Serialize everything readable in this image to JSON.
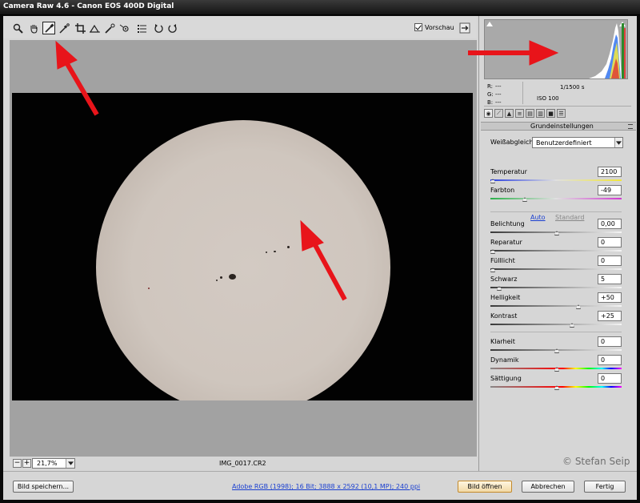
{
  "window": {
    "title": "Camera Raw 4.6 - Canon EOS 400D Digital"
  },
  "toolbar": {
    "tools": [
      {
        "name": "zoom-tool",
        "icon": "magnifier-icon"
      },
      {
        "name": "hand-tool",
        "icon": "hand-icon"
      },
      {
        "name": "white-balance-tool",
        "icon": "eyedropper-icon",
        "selected": true
      },
      {
        "name": "color-sampler-tool",
        "icon": "eyedropper-target-icon"
      },
      {
        "name": "crop-tool",
        "icon": "crop-icon"
      },
      {
        "name": "straighten-tool",
        "icon": "straighten-icon"
      },
      {
        "name": "retouch-tool",
        "icon": "retouch-icon"
      },
      {
        "name": "red-eye-tool",
        "icon": "red-eye-icon"
      },
      {
        "name": "preferences-tool",
        "icon": "list-icon"
      },
      {
        "name": "rotate-left-tool",
        "icon": "rotate-left-icon"
      },
      {
        "name": "rotate-right-tool",
        "icon": "rotate-right-icon"
      }
    ],
    "preview_label": "Vorschau",
    "preview_checked": true
  },
  "canvas": {
    "filename": "IMG_0017.CR2",
    "zoom": "21,7%"
  },
  "histogram": {
    "rgb": [
      {
        "k": "R:",
        "v": "---"
      },
      {
        "k": "G:",
        "v": "---"
      },
      {
        "k": "B:",
        "v": "---"
      }
    ],
    "shutter": "1/1500 s",
    "iso": "ISO 100"
  },
  "panel": {
    "title": "Grundeinstellungen",
    "white_balance_label": "Weißabgleich:",
    "white_balance_value": "Benutzerdefiniert",
    "auto_label": "Auto",
    "standard_label": "Standard",
    "sliders": [
      {
        "label": "Temperatur",
        "value": "2100",
        "pos": 0.0,
        "type": "temp"
      },
      {
        "label": "Farbton",
        "value": "-49",
        "pos": 0.25,
        "type": "tint"
      },
      {
        "label": "Belichtung",
        "value": "0,00",
        "pos": 0.5,
        "type": "gray"
      },
      {
        "label": "Reparatur",
        "value": "0",
        "pos": 0.0,
        "type": "gray"
      },
      {
        "label": "Fülllicht",
        "value": "0",
        "pos": 0.0,
        "type": "gray"
      },
      {
        "label": "Schwarz",
        "value": "5",
        "pos": 0.05,
        "type": "gray"
      },
      {
        "label": "Helligkeit",
        "value": "+50",
        "pos": 0.67,
        "type": "gray"
      },
      {
        "label": "Kontrast",
        "value": "+25",
        "pos": 0.62,
        "type": "gray"
      },
      {
        "label": "Klarheit",
        "value": "0",
        "pos": 0.5,
        "type": "gray"
      },
      {
        "label": "Dynamik",
        "value": "0",
        "pos": 0.5,
        "type": "sat"
      },
      {
        "label": "Sättigung",
        "value": "0",
        "pos": 0.5,
        "type": "sat"
      }
    ]
  },
  "footer": {
    "save_label": "Bild speichern...",
    "workflow_label": "Adobe RGB (1998); 16 Bit; 3888 x 2592 (10,1 MP); 240 ppi",
    "open_label": "Bild öffnen",
    "cancel_label": "Abbrechen",
    "done_label": "Fertig"
  },
  "watermark": "© Stefan Seip",
  "colors": {
    "annotation_arrow": "#e8141a",
    "link": "#1a3fd0",
    "sun": "#cfc6be"
  }
}
